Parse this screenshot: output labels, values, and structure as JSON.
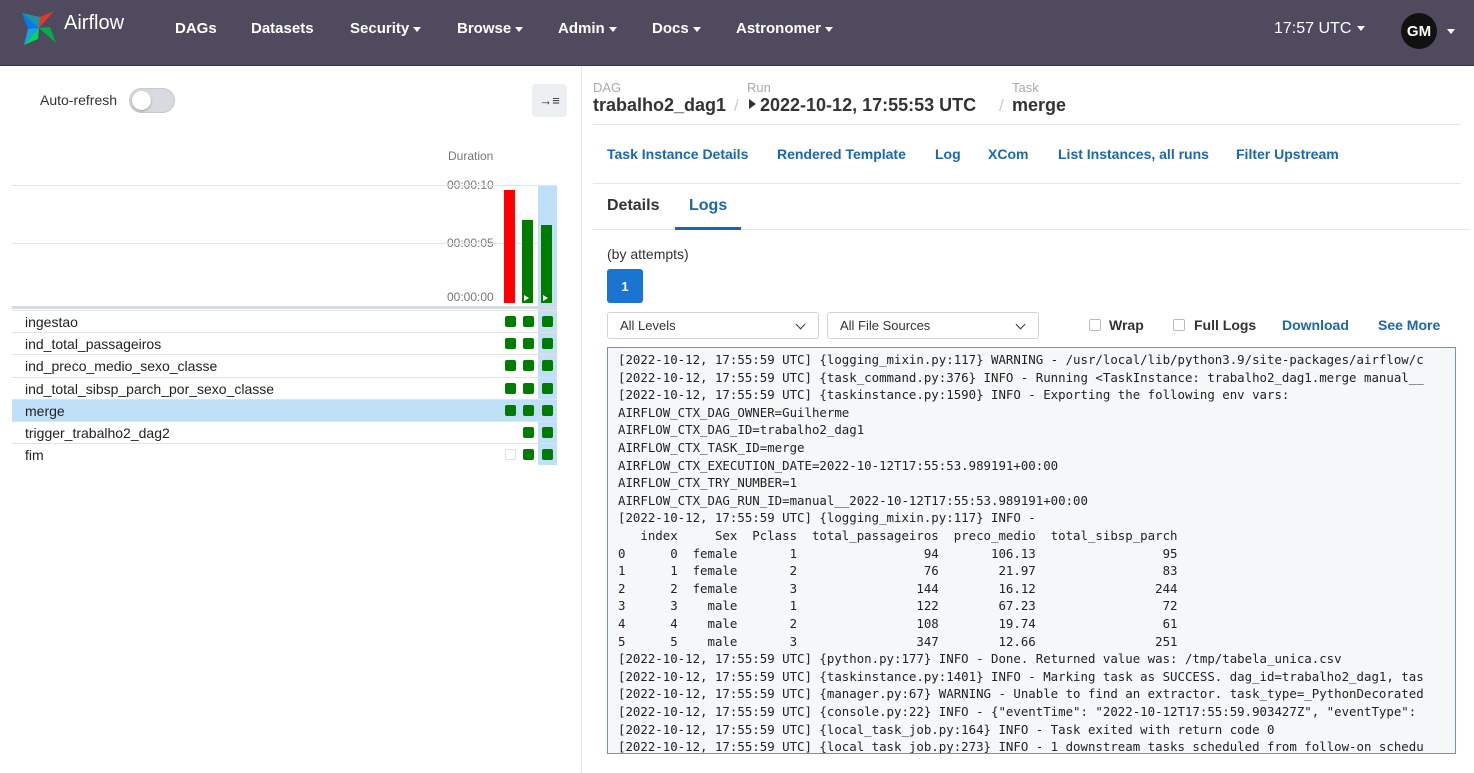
{
  "navbar": {
    "brand": "Airflow",
    "items": [
      {
        "label": "DAGs",
        "dropdown": false
      },
      {
        "label": "Datasets",
        "dropdown": false
      },
      {
        "label": "Security",
        "dropdown": true
      },
      {
        "label": "Browse",
        "dropdown": true
      },
      {
        "label": "Admin",
        "dropdown": true
      },
      {
        "label": "Docs",
        "dropdown": true
      },
      {
        "label": "Astronomer",
        "dropdown": true
      }
    ],
    "time": "17:57 UTC",
    "avatar": "GM"
  },
  "grid": {
    "autorefresh_label": "Auto-refresh",
    "autorefresh_on": false,
    "duration_label": "Duration",
    "duration_ticks": [
      "00:00:10",
      "00:00:05",
      "00:00:00"
    ],
    "run_durations": [
      {
        "seconds": 10.1,
        "status": "failed",
        "color": "#ff0000"
      },
      {
        "seconds": 7.4,
        "status": "success",
        "color": "#007d00"
      },
      {
        "seconds": 7.0,
        "status": "success",
        "color": "#007d00"
      }
    ],
    "tasks": [
      {
        "label": "ingestao",
        "runs": [
          "success",
          "success",
          "success"
        ]
      },
      {
        "label": "ind_total_passageiros",
        "runs": [
          "success",
          "success",
          "success"
        ]
      },
      {
        "label": "ind_preco_medio_sexo_classe",
        "runs": [
          "success",
          "success",
          "success"
        ]
      },
      {
        "label": "ind_total_sibsp_parch_por_sexo_classe",
        "runs": [
          "success",
          "success",
          "success"
        ]
      },
      {
        "label": "merge",
        "runs": [
          "success",
          "success",
          "success"
        ],
        "selected": true
      },
      {
        "label": "trigger_trabalho2_dag2",
        "runs": [
          "none",
          "success",
          "success"
        ]
      },
      {
        "label": "fim",
        "runs": [
          "empty",
          "success",
          "success"
        ]
      }
    ]
  },
  "breadcrumb": {
    "dag_label": "DAG",
    "dag": "trabalho2_dag1",
    "run_label": "Run",
    "run": "2022-10-12, 17:55:53 UTC",
    "task_label": "Task",
    "task": "merge"
  },
  "task_links": [
    "Task Instance Details",
    "Rendered Template",
    "Log",
    "XCom",
    "List Instances, all runs",
    "Filter Upstream"
  ],
  "tabs": {
    "details": "Details",
    "logs": "Logs"
  },
  "logs": {
    "by_attempts": "(by attempts)",
    "attempt": "1",
    "level_select": "All Levels",
    "source_select": "All File Sources",
    "wrap_label": "Wrap",
    "full_logs_label": "Full Logs",
    "download": "Download",
    "see_more": "See More",
    "lines": [
      "[2022-10-12, 17:55:59 UTC] {logging_mixin.py:117} WARNING - /usr/local/lib/python3.9/site-packages/airflow/c",
      "[2022-10-12, 17:55:59 UTC] {task_command.py:376} INFO - Running <TaskInstance: trabalho2_dag1.merge manual__",
      "[2022-10-12, 17:55:59 UTC] {taskinstance.py:1590} INFO - Exporting the following env vars:",
      "AIRFLOW_CTX_DAG_OWNER=Guilherme",
      "AIRFLOW_CTX_DAG_ID=trabalho2_dag1",
      "AIRFLOW_CTX_TASK_ID=merge",
      "AIRFLOW_CTX_EXECUTION_DATE=2022-10-12T17:55:53.989191+00:00",
      "AIRFLOW_CTX_TRY_NUMBER=1",
      "AIRFLOW_CTX_DAG_RUN_ID=manual__2022-10-12T17:55:53.989191+00:00",
      "[2022-10-12, 17:55:59 UTC] {logging_mixin.py:117} INFO -",
      "   index     Sex  Pclass  total_passageiros  preco_medio  total_sibsp_parch",
      "0      0  female       1                 94       106.13                 95",
      "1      1  female       2                 76        21.97                 83",
      "2      2  female       3                144        16.12                244",
      "3      3    male       1                122        67.23                 72",
      "4      4    male       2                108        19.74                 61",
      "5      5    male       3                347        12.66                251",
      "[2022-10-12, 17:55:59 UTC] {python.py:177} INFO - Done. Returned value was: /tmp/tabela_unica.csv",
      "[2022-10-12, 17:55:59 UTC] {taskinstance.py:1401} INFO - Marking task as SUCCESS. dag_id=trabalho2_dag1, tas",
      "[2022-10-12, 17:55:59 UTC] {manager.py:67} WARNING - Unable to find an extractor. task_type=_PythonDecorated",
      "[2022-10-12, 17:55:59 UTC] {console.py:22} INFO - {\"eventTime\": \"2022-10-12T17:55:59.903427Z\", \"eventType\":",
      "[2022-10-12, 17:55:59 UTC] {local_task_job.py:164} INFO - Task exited with return code 0",
      "[2022-10-12, 17:55:59 UTC] {local_task_job.py:273} INFO - 1 downstream tasks scheduled from follow-on schedu"
    ]
  }
}
